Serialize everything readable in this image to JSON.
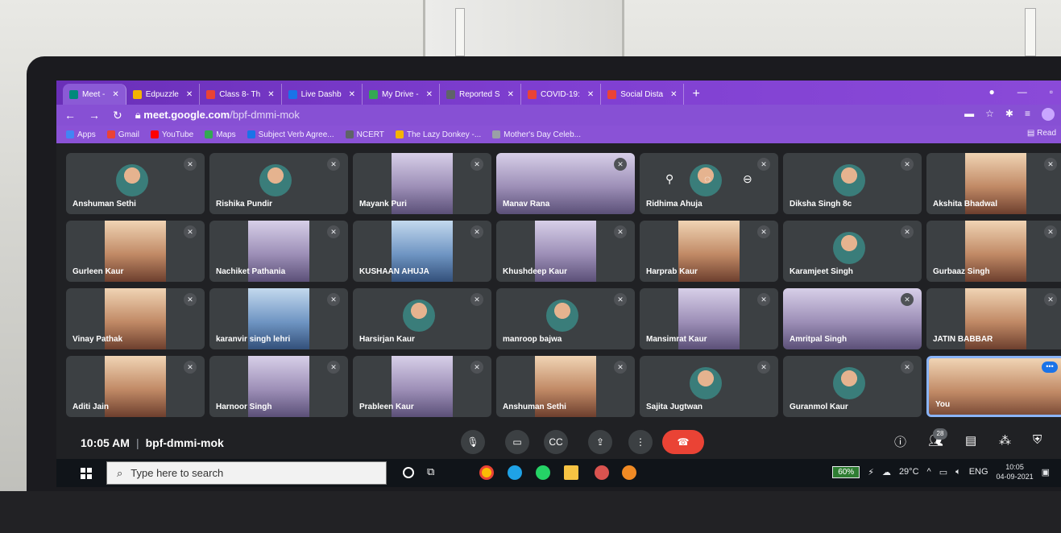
{
  "tabs": [
    {
      "label": "Meet - ",
      "color": "#00897b",
      "active": true
    },
    {
      "label": "Edpuzzle",
      "color": "#f4b400"
    },
    {
      "label": "Class 8- Th",
      "color": "#ea4335"
    },
    {
      "label": "Live Dashb",
      "color": "#1a73e8"
    },
    {
      "label": "My Drive - ",
      "color": "#34a853"
    },
    {
      "label": "Reported S",
      "color": "#5f6368"
    },
    {
      "label": "COVID-19: ",
      "color": "#ea4335"
    },
    {
      "label": "Social Dista",
      "color": "#ea4335"
    }
  ],
  "address": {
    "host": "meet.google.com",
    "path": "/bpf-dmmi-mok"
  },
  "bookmarks": [
    {
      "label": "Apps",
      "color": "#4285f4"
    },
    {
      "label": "Gmail",
      "color": "#ea4335"
    },
    {
      "label": "YouTube",
      "color": "#ff0000"
    },
    {
      "label": "Maps",
      "color": "#34a853"
    },
    {
      "label": "Subject Verb Agree...",
      "color": "#1a73e8"
    },
    {
      "label": "NCERT",
      "color": "#5f6368"
    },
    {
      "label": "The Lazy Donkey -...",
      "color": "#f4b400"
    },
    {
      "label": "Mother's Day Celeb...",
      "color": "#9aa0a6"
    }
  ],
  "reading_list": "Read",
  "participants": [
    {
      "name": "Anshuman Sethi",
      "kind": "avatar"
    },
    {
      "name": "Rishika Pundir",
      "kind": "avatar"
    },
    {
      "name": "Mayank Puri",
      "kind": "video"
    },
    {
      "name": "Manav Rana",
      "kind": "video-wide"
    },
    {
      "name": "Ridhima Ahuja",
      "kind": "avatar"
    },
    {
      "name": "Diksha Singh 8c",
      "kind": "avatar"
    },
    {
      "name": "Akshita Bhadwal",
      "kind": "video-warm"
    },
    {
      "name": "Gurleen Kaur",
      "kind": "video-warm"
    },
    {
      "name": "Nachiket Pathania",
      "kind": "video"
    },
    {
      "name": "KUSHAAN AHUJA",
      "kind": "video-blue"
    },
    {
      "name": "Khushdeep Kaur",
      "kind": "video"
    },
    {
      "name": "Harprab Kaur",
      "kind": "video-warm"
    },
    {
      "name": "Karamjeet Singh",
      "kind": "avatar"
    },
    {
      "name": "Gurbaaz Singh",
      "kind": "video-warm"
    },
    {
      "name": "Vinay Pathak",
      "kind": "video-warm"
    },
    {
      "name": "karanvir singh lehri",
      "kind": "video-blue"
    },
    {
      "name": "Harsirjan Kaur",
      "kind": "avatar"
    },
    {
      "name": "manroop bajwa",
      "kind": "avatar"
    },
    {
      "name": "Mansimrat Kaur",
      "kind": "video"
    },
    {
      "name": "Amritpal Singh",
      "kind": "video-wide"
    },
    {
      "name": "JATIN BABBAR",
      "kind": "video-warm"
    },
    {
      "name": "Aditi Jain",
      "kind": "video-warm"
    },
    {
      "name": "Harnoor Singh",
      "kind": "video"
    },
    {
      "name": "Prableen Kaur",
      "kind": "video"
    },
    {
      "name": "Anshuman Sethi",
      "kind": "video-warm"
    },
    {
      "name": "Sajita Jugtwan",
      "kind": "avatar"
    },
    {
      "name": "Guranmol Kaur",
      "kind": "avatar"
    },
    {
      "name": "You",
      "kind": "self"
    }
  ],
  "meeting": {
    "time": "10:05 AM",
    "code": "bpf-dmmi-mok",
    "people_count": "28"
  },
  "taskbar": {
    "search_placeholder": "Type here to search",
    "battery": "60%",
    "temperature": "29°C",
    "language": "ENG",
    "time": "10:05",
    "date": "04-09-2021"
  }
}
